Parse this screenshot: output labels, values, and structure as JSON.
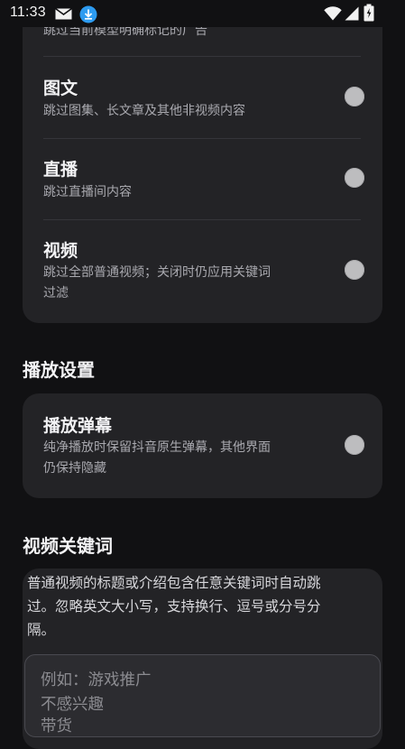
{
  "status_bar": {
    "time": "11:33",
    "icons": [
      "mail-icon",
      "download-icon",
      "wifi-icon",
      "signal-icon",
      "battery-icon"
    ]
  },
  "filter_card": {
    "partial_item": {
      "description": "跳过当前模型明确标记的广告"
    },
    "items": [
      {
        "title": "图文",
        "description": "跳过图集、长文章及其他非视频内容",
        "checked": false
      },
      {
        "title": "直播",
        "description": "跳过直播间内容",
        "checked": false
      },
      {
        "title": "视频",
        "description_lines": [
          "跳过全部普通视频；关闭时仍应用关键词",
          "过滤"
        ],
        "checked": false
      }
    ]
  },
  "playback_section": {
    "title": "播放设置",
    "item": {
      "title": "播放弹幕",
      "description_lines": [
        "纯净播放时保留抖音原生弹幕，其他界面",
        "仍保持隐藏"
      ],
      "checked": false
    }
  },
  "keywords_section": {
    "title": "视频关键词",
    "description_lines": [
      "普通视频的标题或介绍包含任意关键词时自动跳",
      "过。忽略英文大小写，支持换行、逗号或分号分",
      "隔。"
    ],
    "placeholder_lines": [
      "例如：游戏推广",
      "不感兴趣",
      "带货"
    ]
  },
  "colors": {
    "background": "#111113",
    "card": "#232326",
    "radio_off": "#bdbdbf",
    "secondary_text": "#a9a9af"
  }
}
